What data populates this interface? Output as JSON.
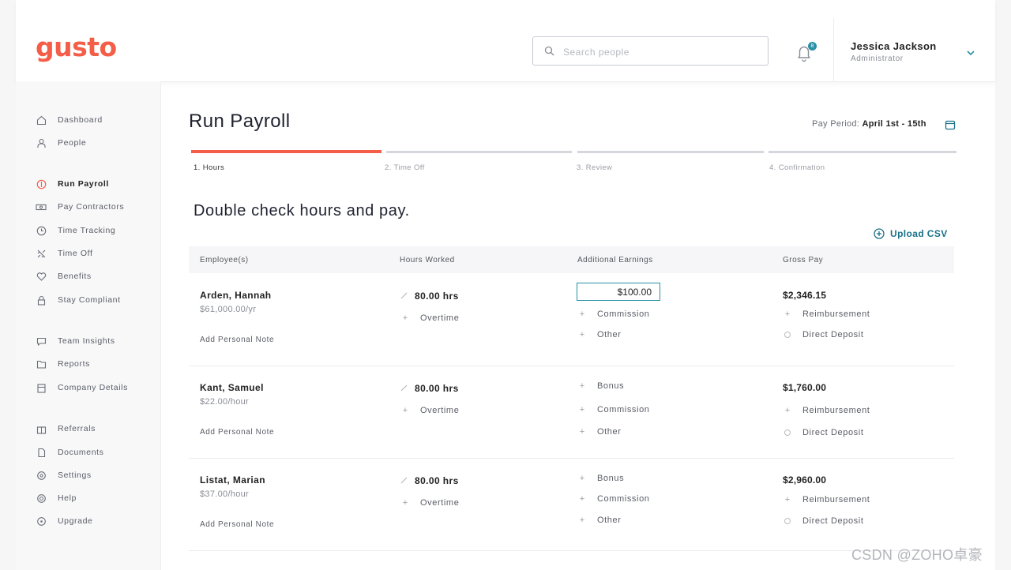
{
  "app": {
    "logo": "gusto"
  },
  "header": {
    "search_placeholder": "Search people",
    "notification_count": "8",
    "user_name": "Jessica Jackson",
    "user_role": "Administrator"
  },
  "sidebar": {
    "items": [
      {
        "label": "Dashboard",
        "icon": "home-icon"
      },
      {
        "label": "People",
        "icon": "person-icon"
      },
      {
        "label": "Run Payroll",
        "icon": "payroll-icon",
        "active": true
      },
      {
        "label": "Pay Contractors",
        "icon": "cash-icon"
      },
      {
        "label": "Time Tracking",
        "icon": "clock-icon"
      },
      {
        "label": "Time Off",
        "icon": "plane-icon"
      },
      {
        "label": "Benefits",
        "icon": "heart-icon"
      },
      {
        "label": "Stay Compliant",
        "icon": "lock-icon"
      },
      {
        "label": "Team Insights",
        "icon": "chat-icon"
      },
      {
        "label": "Reports",
        "icon": "folder-icon"
      },
      {
        "label": "Company Details",
        "icon": "building-icon"
      },
      {
        "label": "Referrals",
        "icon": "gift-icon"
      },
      {
        "label": "Documents",
        "icon": "document-icon"
      },
      {
        "label": "Settings",
        "icon": "gear-icon"
      },
      {
        "label": "Help",
        "icon": "help-icon"
      },
      {
        "label": "Upgrade",
        "icon": "upgrade-icon"
      }
    ]
  },
  "main": {
    "title": "Run Payroll",
    "pay_period_label": "Pay Period:",
    "pay_period_value": "April 1st - 15th",
    "steps": [
      {
        "label": "1. Hours",
        "active": true
      },
      {
        "label": "2. Time Off"
      },
      {
        "label": "3. Review"
      },
      {
        "label": "4. Confirmation"
      }
    ],
    "subtitle": "Double check hours and pay.",
    "upload_label": "Upload CSV",
    "columns": [
      "Employee(s)",
      "Hours Worked",
      "Additional Earnings",
      "Gross Pay"
    ],
    "add_note_label": "Add Personal Note",
    "overtime_label": "Overtime",
    "rows": [
      {
        "name": "Arden, Hannah",
        "rate": "$61,000.00/yr",
        "hours": "80.00 hrs",
        "earning_input": "$100.00",
        "earnings": [
          "Commission",
          "Other"
        ],
        "gross": "$2,346.15",
        "reimbursement": "Reimbursement",
        "deposit": "Direct Deposit"
      },
      {
        "name": "Kant, Samuel",
        "rate": "$22.00/hour",
        "hours": "80.00 hrs",
        "earnings": [
          "Bonus",
          "Commission",
          "Other"
        ],
        "gross": "$1,760.00",
        "reimbursement": "Reimbursement",
        "deposit": "Direct Deposit"
      },
      {
        "name": "Listat, Marian",
        "rate": "$37.00/hour",
        "hours": "80.00 hrs",
        "earnings": [
          "Bonus",
          "Commission",
          "Other"
        ],
        "gross": "$2,960.00",
        "reimbursement": "Reimbursement",
        "deposit": "Direct Deposit"
      }
    ]
  },
  "watermark": "CSDN @ZOHO卓豪",
  "colors": {
    "brand": "#f45d48",
    "accent": "#1a7189"
  }
}
